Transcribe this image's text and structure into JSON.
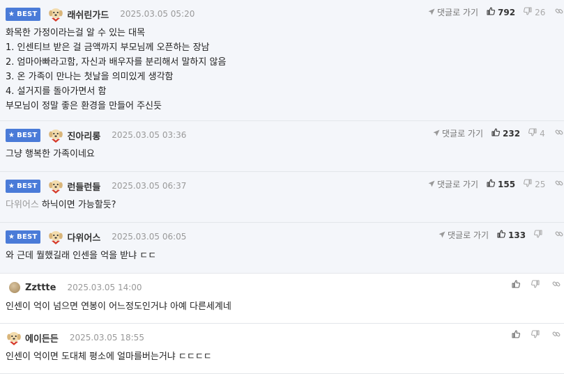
{
  "labels": {
    "best": "BEST",
    "reply": "댓글로 가기"
  },
  "comments": [
    {
      "best": true,
      "avatar": "puppy-icon",
      "nick": "래쉬린가드",
      "date": "2025.03.05 05:20",
      "likes": "792",
      "dislikes": "26",
      "lines": [
        "화목한 가정이라는걸 알 수 있는 대목",
        "1. 인센티브 받은 걸 금액까지 부모님께 오픈하는 장남",
        "2. 엄마아빠라고함, 자신과 배우자를 분리해서 말하지 않음",
        "3. 온 가족이 만나는 첫날을 의미있게 생각함",
        "4. 설거지를 돌아가면서 함",
        "부모님이 정말 좋은 환경을 만들어 주신듯"
      ]
    },
    {
      "best": true,
      "avatar": "puppy-icon",
      "nick": "진아리롱",
      "date": "2025.03.05 03:36",
      "likes": "232",
      "dislikes": "4",
      "lines": [
        "그냥 행복한 가족이네요"
      ]
    },
    {
      "best": true,
      "avatar": "puppy-icon",
      "nick": "런들런들",
      "date": "2025.03.05 06:37",
      "likes": "155",
      "dislikes": "25",
      "ref": "다위어스",
      "lines": [
        "하닉이면 가능할듯?"
      ]
    },
    {
      "best": true,
      "avatar": "puppy-icon",
      "nick": "다위어스",
      "date": "2025.03.05 06:05",
      "likes": "133",
      "dislikes": "",
      "lines": [
        "와 근데 뭘했길래 인센을 억을 받냐 ㄷㄷ"
      ]
    },
    {
      "best": false,
      "avatar": "coin-icon",
      "nick": "Zzttte",
      "date": "2025.03.05 14:00",
      "likes": "",
      "dislikes": "",
      "lines": [
        "인센이 억이 넘으면 연봉이 어느정도인거냐 아예 다른세계네"
      ]
    },
    {
      "best": false,
      "avatar": "puppy-icon",
      "nick": "에이든든",
      "date": "2025.03.05 18:55",
      "likes": "",
      "dislikes": "",
      "lines": [
        "인센이 억이면 도대체 평소에 얼마를버는거냐 ㄷㄷㄷㄷ"
      ]
    }
  ]
}
